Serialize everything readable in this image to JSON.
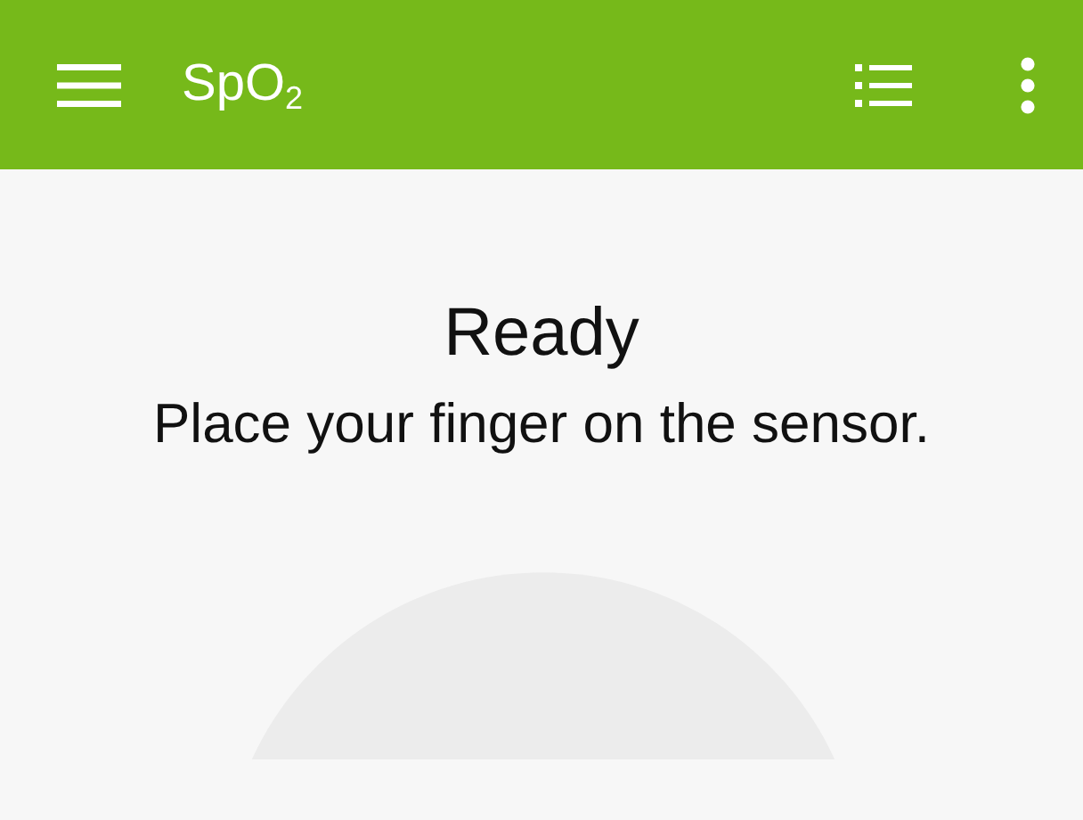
{
  "app_bar": {
    "title": "SpO$_{2}$"
  },
  "status": {
    "heading": "Ready",
    "message": "Place your finger on the sensor."
  }
}
